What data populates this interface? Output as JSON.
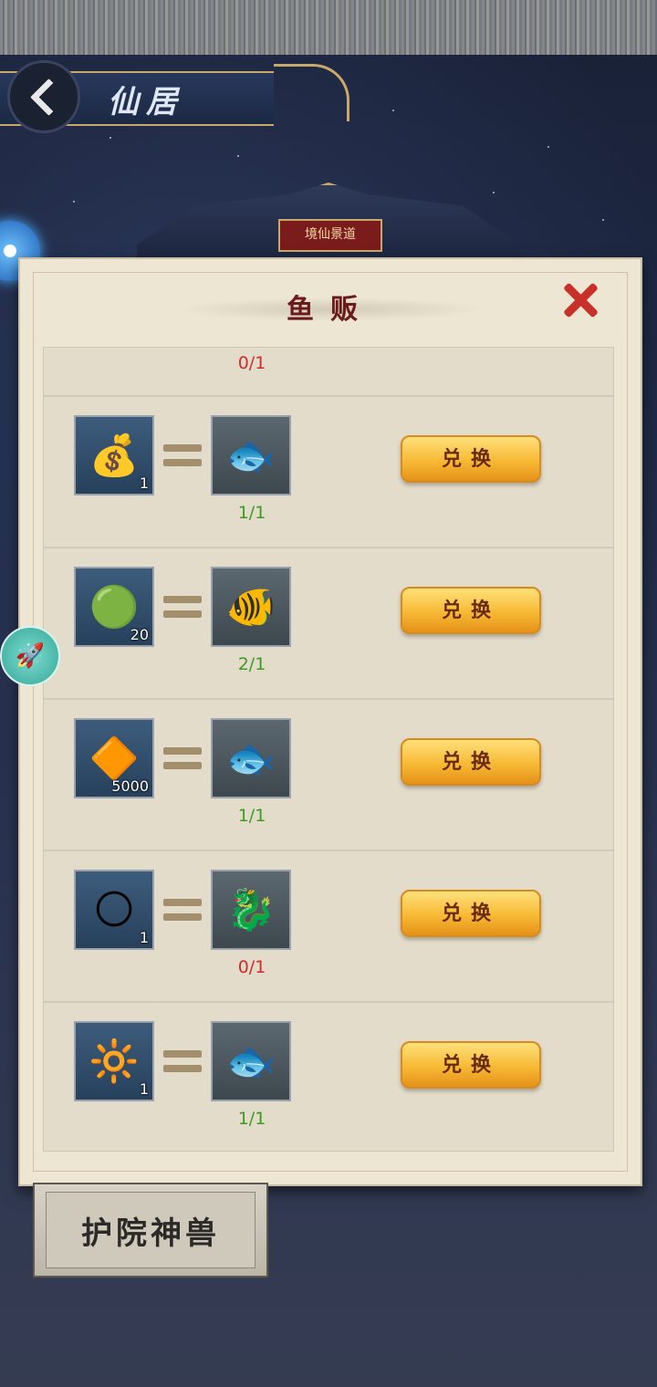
{
  "header": {
    "title": "仙居",
    "back_icon": "back-chevron-icon"
  },
  "pavilion": {
    "sign_text": "境仙景道"
  },
  "dialog": {
    "title": "鱼贩",
    "close_icon": "close-x-icon"
  },
  "partial_row": {
    "progress": "0/1",
    "progress_color": "#d12b2b"
  },
  "rows": [
    {
      "cost_item": "treasure-bag-icon",
      "cost_glyph": "💰",
      "cost_qty": "1",
      "reward_item": "blue-fish-icon",
      "reward_glyph": "🐟",
      "progress": "1/1",
      "progress_color": "#3f9a24",
      "button": "兑换"
    },
    {
      "cost_item": "jade-stone-icon",
      "cost_glyph": "🟢",
      "cost_qty": "20",
      "reward_item": "golden-carp-icon",
      "reward_glyph": "🐠",
      "progress": "2/1",
      "progress_color": "#3f9a24",
      "button": "兑换"
    },
    {
      "cost_item": "amber-crystal-icon",
      "cost_glyph": "🔶",
      "cost_qty": "5000",
      "reward_item": "dark-fish-icon",
      "reward_glyph": "🐟",
      "progress": "1/1",
      "progress_color": "#3f9a24",
      "button": "兑换"
    },
    {
      "cost_item": "golden-orb-icon",
      "cost_glyph": "🌕",
      "cost_qty": "1",
      "reward_item": "arowana-icon",
      "reward_glyph": "🐉",
      "progress": "0/1",
      "progress_color": "#d12b2b",
      "button": "兑换"
    },
    {
      "cost_item": "spirit-sphere-icon",
      "cost_glyph": "🔆",
      "cost_qty": "1",
      "reward_item": "silver-fish-icon",
      "reward_glyph": "🐟",
      "progress": "1/1",
      "progress_color": "#3f9a24",
      "button": "兑换"
    }
  ],
  "side_buttons": {
    "rocket_icon": "rocket-icon",
    "rocket_glyph": "🚀",
    "orb_icon": "spirit-orb-icon"
  },
  "bottom_tab": {
    "label": "护院神兽"
  }
}
